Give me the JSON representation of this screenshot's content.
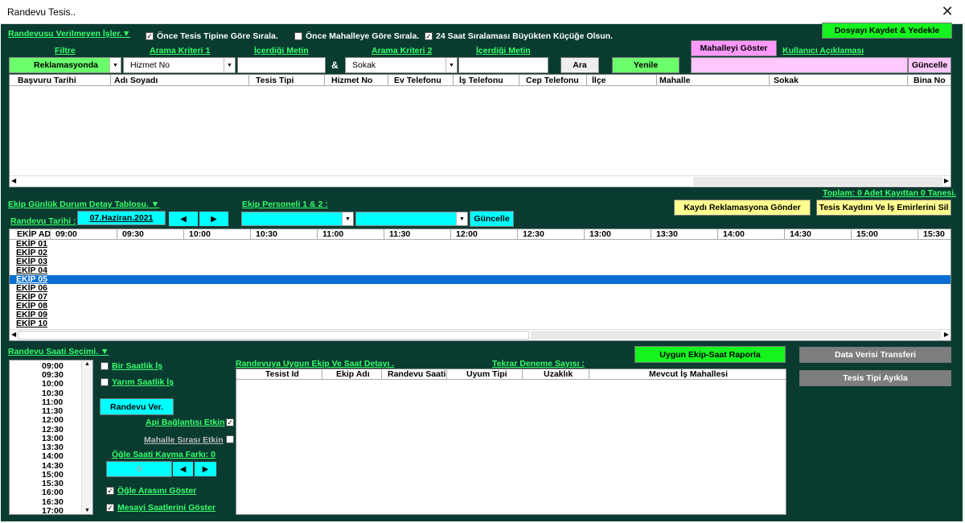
{
  "window": {
    "title": "Randevu Tesis..",
    "close_glyph": "✕"
  },
  "top": {
    "section_label": "Randevusu Verilmeyen İşler.▼",
    "check1": {
      "label": "Önce Tesis Tipine Göre Sırala.",
      "checked": true
    },
    "check2": {
      "label": "Önce Mahalleye Göre Sırala.",
      "checked": false
    },
    "check3": {
      "label": "24 Saat Sıralaması Büyükten Küçüğe Olsun.",
      "checked": true
    },
    "save_button": "Dosyayı Kaydet & Yedekle",
    "filter_label": "Filtre",
    "criteria1_label": "Arama Kriteri 1",
    "content1_label": "İçerdiği Metin",
    "criteria2_label": "Arama Kriteri 2",
    "content2_label": "İçerdiği Metin",
    "show_neighborhood_button": "Mahalleyi Göster",
    "user_note_label": "Kullanıcı Açıklaması",
    "filter_value": "Reklamasyonda",
    "criteria1_value": "Hizmet No",
    "amp": "&",
    "criteria2_value": "Sokak",
    "search_button": "Ara",
    "refresh_button": "Yenile",
    "update_button": "Güncelle"
  },
  "table1": {
    "columns": [
      "Başvuru Tarihi",
      "Adı Soyadı",
      "Tesis Tipi",
      "Hizmet No",
      "Ev Telefonu",
      "İş Telefonu",
      "Cep Telefonu",
      "İlçe",
      "Mahalle",
      "Sokak",
      "Bina No"
    ],
    "total": "Toplam: 0 Adet Kayıttan 0 Tanesi."
  },
  "middle": {
    "section_label": "Ekip Günlük Durum Detay Tablosu. ▼",
    "personnel_label": "Ekip Personeli 1 & 2 :",
    "date_label": "Randevu Tarihi :",
    "date_value": "07.Haziran.2021",
    "update_button": "Güncelle",
    "send_complaint_button": "Kaydı Reklamasyona Gönder",
    "delete_button": "Tesis Kaydını Ve İş Emirlerini Sil"
  },
  "table2": {
    "first_col": "EKİP AD",
    "times": [
      "09:00",
      "09:30",
      "10:00",
      "10:30",
      "11:00",
      "11:30",
      "12:00",
      "12:30",
      "13:00",
      "13:30",
      "14:00",
      "14:30",
      "15:00",
      "15:30"
    ],
    "rows": [
      "EKİP 01",
      "EKİP 02",
      "EKİP 03",
      "EKİP 04",
      "EKİP 05",
      "EKİP 06",
      "EKİP 07",
      "EKİP 08",
      "EKİP 09",
      "EKİP 10"
    ],
    "selected_row": 4
  },
  "bottom": {
    "section_label": "Randevu Saati Seçimi. ▼",
    "times": [
      "09:00",
      "09:30",
      "10:00",
      "10:30",
      "11:00",
      "11:30",
      "12:00",
      "12:30",
      "13:00",
      "13:30",
      "14:00",
      "14:30",
      "15:00",
      "15:30",
      "16:00",
      "16:30",
      "17:00"
    ],
    "one_hour": "Bir Saatlik İş",
    "half_hour": "Yarım Saatlik İş",
    "give_appointment": "Randevu Ver.",
    "api_label": "Api Bağlantısı Etkin",
    "neighborhood_order_label": "Mahalle Sırası Etkin",
    "noon_shift_label": "Öğle Saati Kayma Farkı: 0",
    "noon_shift_value": "0",
    "show_lunch_label": "Öğle Arasını Göster",
    "show_hours_label": "Mesayi Saatlerini Göster",
    "suitable_label": "Randevuya Uygun Ekip Ve Saat Detayı .",
    "retry_label": "Tekrar Deneme Sayısı :",
    "report_button": "Uygun Ekip-Saat Raporla",
    "data_transfer_button": "Data Verisi Transferi",
    "facility_type_button": "Tesis Tipi Ayıkla",
    "columns": [
      "Tesist Id",
      "Ekip Adı",
      "Randevu Saati",
      "Uyum Tipi",
      "Uzaklık",
      "Mevcut İş Mahallesi"
    ]
  }
}
